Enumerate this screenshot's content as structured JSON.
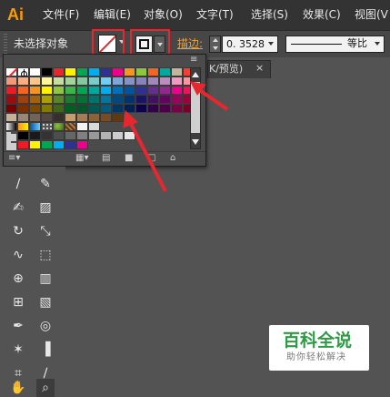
{
  "app": {
    "logo": "Ai"
  },
  "menu": {
    "items": [
      "文件(F)",
      "编辑(E)",
      "对象(O)",
      "文字(T)",
      "选择(S)",
      "效果(C)",
      "视图(V"
    ]
  },
  "control_bar": {
    "selection_status": "未选择对象",
    "stroke_label": "描边:",
    "stroke_weight": "0. 3528",
    "profile_label": "等比"
  },
  "doc_tab": {
    "title": "K/预览)",
    "close": "×"
  },
  "swatches_panel": {
    "menu_icon": "≡",
    "rows": [
      [
        "none",
        "registration",
        "#ffffff",
        "#000000",
        "#e8262e",
        "#fff200",
        "#00a651",
        "#00aeef",
        "#2e3192",
        "#ec008c",
        "#f7941d",
        "#8dc63f",
        "#f26522",
        "#00a99d",
        "#c2b59b",
        "#ef4136"
      ],
      [
        "#f7977a",
        "#fbad82",
        "#fdc689",
        "#fff799",
        "#c4df9b",
        "#a3d39c",
        "#82ca9c",
        "#7accc8",
        "#6dcff6",
        "#7da7d9",
        "#8393ca",
        "#8781bd",
        "#a187be",
        "#bd8cbf",
        "#f49ac2",
        "#f6989d"
      ],
      [
        "#ed1c24",
        "#f26522",
        "#f7941d",
        "#fff200",
        "#8dc63f",
        "#39b54a",
        "#00a651",
        "#00a99d",
        "#00aeef",
        "#0072bc",
        "#0054a6",
        "#2e3192",
        "#662d91",
        "#92278f",
        "#ec008c",
        "#ed145b"
      ],
      [
        "#9e0b0f",
        "#a0410d",
        "#a36209",
        "#aba000",
        "#598527",
        "#1a7b30",
        "#007236",
        "#00746b",
        "#0076a3",
        "#004a80",
        "#003471",
        "#1b1464",
        "#440e62",
        "#630460",
        "#9e005d",
        "#9e0039"
      ],
      [
        "#790000",
        "#7b2e00",
        "#7d4900",
        "#827b00",
        "#406618",
        "#005e20",
        "#005826",
        "#005952",
        "#005b7f",
        "#003663",
        "#002157",
        "#0d004c",
        "#32004b",
        "#4b0049",
        "#7b0046",
        "#7a0026"
      ],
      [
        "#c7b299",
        "#998675",
        "#736357",
        "#534741",
        "#37302a",
        "#c69c6d",
        "#a67c52",
        "#8c6239",
        "#754c24",
        "#603913"
      ],
      [
        "grad-white-black",
        "grad-orange-yellow",
        "grad-blue",
        "pattern-dots",
        "pattern-leaf",
        "pattern-brown",
        "#f2f2f2",
        "#d9d9d9"
      ],
      [
        "folder",
        "#000000",
        "#1a1a1a",
        "#333333",
        "#4d4d4d",
        "#666666",
        "#808080",
        "#999999",
        "#b3b3b3",
        "#cccccc",
        "#e6e6e6"
      ],
      [
        "folder",
        "#ed1c24",
        "#fff200",
        "#00a651",
        "#00aeef",
        "#2e3192",
        "#ec008c"
      ]
    ]
  },
  "annotations": {
    "highlight_color": "#e8262e"
  },
  "watermark": {
    "title": "百科全说",
    "subtitle": "助你轻松解决"
  },
  "toolbox": {
    "tools": [
      "paintbrush-icon",
      "pencil-icon",
      "blob-brush-icon",
      "eraser-icon",
      "rotate-icon",
      "scale-icon",
      "warp-icon",
      "free-transform-icon",
      "shape-builder-icon",
      "perspective-grid-icon",
      "mesh-icon",
      "gradient-icon",
      "eyedropper-icon",
      "blend-icon",
      "symbol-sprayer-icon",
      "column-graph-icon",
      "artboard-icon",
      "slice-icon",
      "hand-icon",
      "zoom-icon"
    ]
  }
}
